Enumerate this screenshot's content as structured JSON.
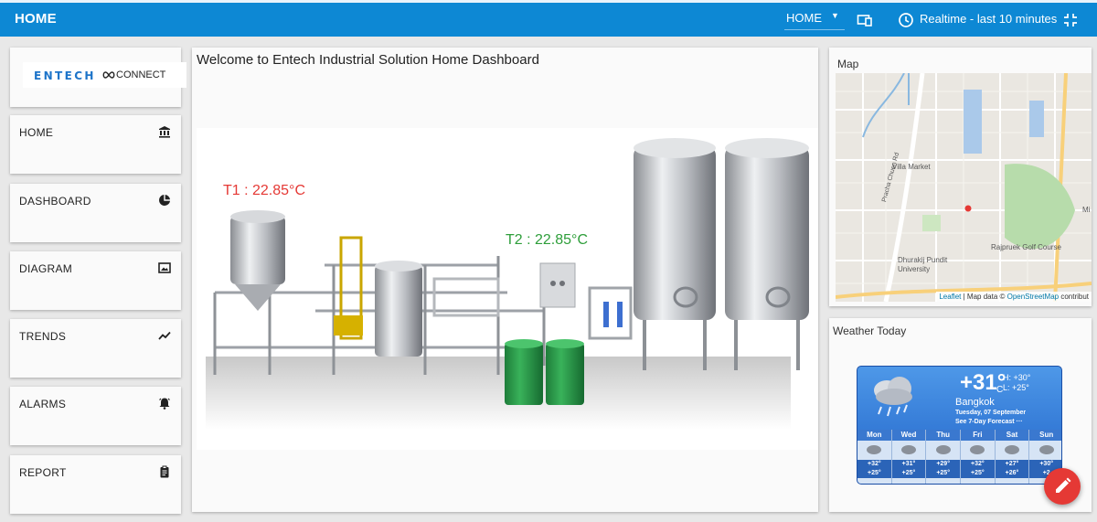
{
  "topbar": {
    "title": "HOME",
    "dashboard_select": "HOME",
    "timewindow": "Realtime - last 10 minutes"
  },
  "logo": {
    "brand": "ENTECH",
    "suffix": "CONNECT"
  },
  "sidebar": {
    "items": [
      {
        "label": "HOME",
        "icon": "bank-icon"
      },
      {
        "label": "DASHBOARD",
        "icon": "pie-chart-icon"
      },
      {
        "label": "DIAGRAM",
        "icon": "image-icon"
      },
      {
        "label": "TRENDS",
        "icon": "trending-icon"
      },
      {
        "label": "ALARMS",
        "icon": "bell-icon"
      },
      {
        "label": "REPORT",
        "icon": "clipboard-icon"
      }
    ]
  },
  "main": {
    "welcome": "Welcome to Entech Industrial Solution Home Dashboard",
    "t1": {
      "label": "T1 : 22.85°C",
      "color": "#e53935"
    },
    "t2": {
      "label": "T2 : 22.85°C",
      "color": "#2e9e3a"
    }
  },
  "map": {
    "title": "Map",
    "places": [
      "Villa Market",
      "Pracha Chuen Rd",
      "Dhurakij Pundit",
      "University",
      "Rajpruek Golf Course",
      "Mi"
    ],
    "attribution": {
      "leaflet": "Leaflet",
      "sep": " | Map data © ",
      "osm": "OpenStreetMap",
      "tail": " contribut"
    }
  },
  "weather": {
    "title": "Weather Today",
    "temp": "+31°",
    "unit": "C",
    "high": "H: +30°",
    "low": "L: +25°",
    "city": "Bangkok",
    "date": "Tuesday, 07 September",
    "forecast_link": "See 7-Day Forecast ···",
    "days": [
      {
        "day": "Mon",
        "hi": "+32°",
        "lo": "+25°"
      },
      {
        "day": "Wed",
        "hi": "+31°",
        "lo": "+25°"
      },
      {
        "day": "Thu",
        "hi": "+29°",
        "lo": "+25°"
      },
      {
        "day": "Fri",
        "hi": "+32°",
        "lo": "+25°"
      },
      {
        "day": "Sat",
        "hi": "+27°",
        "lo": "+26°"
      },
      {
        "day": "Sun",
        "hi": "+30°",
        "lo": "+2"
      }
    ]
  },
  "colors": {
    "topbar": "#0d88d4",
    "accent_fab": "#e53935"
  }
}
